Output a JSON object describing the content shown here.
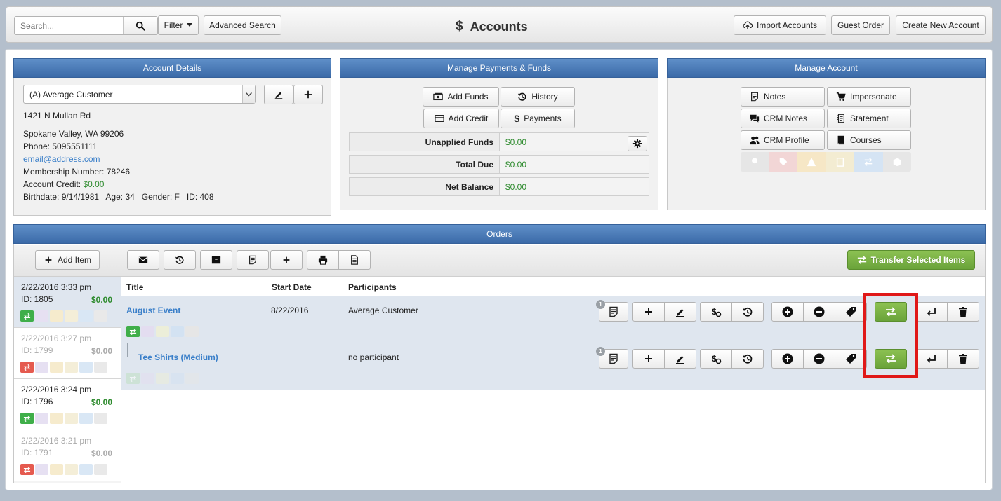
{
  "top": {
    "search_placeholder": "Search...",
    "filter_label": "Filter",
    "advanced_search_label": "Advanced Search",
    "page_title": "Accounts",
    "title_icon": "$",
    "import_label": "Import Accounts",
    "guest_order_label": "Guest Order",
    "create_account_label": "Create New Account"
  },
  "account_details": {
    "header": "Account Details",
    "selected_account": "(A) Average Customer",
    "address1": "1421 N Mullan Rd",
    "address2": "Spokane Valley, WA 99206",
    "phone": "Phone: 5095551111",
    "email": "email@address.com",
    "membership": "Membership Number: 78246",
    "credit_label": "Account Credit:",
    "credit_value": "$0.00",
    "birth_line": "Birthdate: 9/14/1981   Age: 34   Gender: F   ID: 408"
  },
  "payments": {
    "header": "Manage Payments & Funds",
    "add_funds": "Add Funds",
    "history": "History",
    "add_credit": "Add Credit",
    "payments": "Payments",
    "rows": [
      {
        "label": "Unapplied Funds",
        "value": "$0.00"
      },
      {
        "label": "Total Due",
        "value": "$0.00"
      },
      {
        "label": "Net Balance",
        "value": "$0.00"
      }
    ]
  },
  "manage": {
    "header": "Manage Account",
    "notes": "Notes",
    "impersonate": "Impersonate",
    "crm_notes": "CRM Notes",
    "statement": "Statement",
    "crm_profile": "CRM Profile",
    "courses": "Courses"
  },
  "orders": {
    "header": "Orders",
    "add_item": "Add Item",
    "transfer_label": "Transfer Selected Items",
    "columns": {
      "title": "Title",
      "start_date": "Start Date",
      "participants": "Participants"
    },
    "sidebar": [
      {
        "date": "2/22/2016 3:33 pm",
        "id": "ID: 1805",
        "amount": "$0.00"
      },
      {
        "date": "2/22/2016 3:27 pm",
        "id": "ID: 1799",
        "amount": "$0.00"
      },
      {
        "date": "2/22/2016 3:24 pm",
        "id": "ID: 1796",
        "amount": "$0.00"
      },
      {
        "date": "2/22/2016 3:21 pm",
        "id": "ID: 1791",
        "amount": "$0.00"
      }
    ],
    "items": [
      {
        "title": "August Event",
        "start_date": "8/22/2016",
        "participants": "Average Customer",
        "note_count": "1"
      },
      {
        "title": "Tee Shirts (Medium)",
        "start_date": "",
        "participants": "no participant",
        "note_count": "1"
      }
    ]
  },
  "colors": {
    "header_blue": "#4a7bbd",
    "green": "#2e8b2e",
    "transfer_green": "#7cb342",
    "highlight": "#e01818"
  }
}
